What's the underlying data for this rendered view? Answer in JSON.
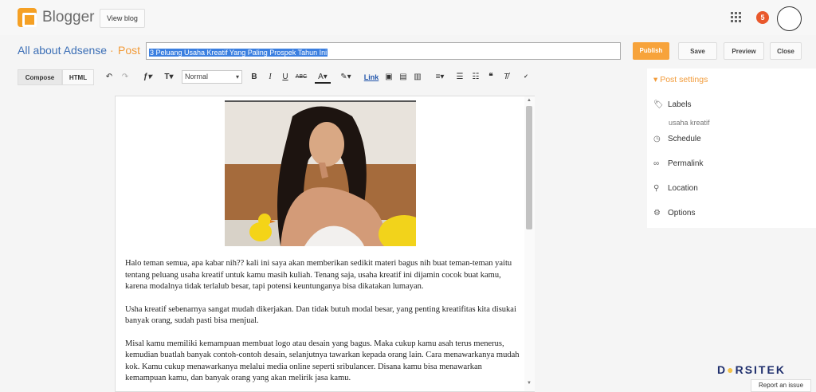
{
  "header": {
    "brand": "Blogger",
    "view_blog_label": "View blog",
    "notification_count": "5"
  },
  "title_row": {
    "blog_name": "All about Adsense",
    "separator": "·",
    "post_label": "Post",
    "title_value": "3 Peluang Usaha Kreatif Yang Paling Prospek Tahun Ini"
  },
  "actions": {
    "publish": "Publish",
    "save": "Save",
    "preview": "Preview",
    "close": "Close"
  },
  "toolbar": {
    "compose": "Compose",
    "html": "HTML",
    "font_size_icon": "ƒ",
    "text_size_icon": "T",
    "format_select": "Normal",
    "bold": "B",
    "italic": "I",
    "underline": "U",
    "strike": "ABC",
    "link": "Link"
  },
  "post": {
    "paragraphs": [
      "Halo teman semua, apa kabar nih?? kali ini saya akan memberikan sedikit materi bagus nih buat teman-teman yaitu tentang peluang usaha kreatif untuk kamu masih kuliah. Tenang saja, usaha kreatif ini dijamin cocok buat kamu, karena modalnya tidak terlalub besar, tapi potensi keuntunganya bisa dikatakan lumayan.",
      "Usha kreatif sebenarnya sangat mudah dikerjakan. Dan tidak butuh modal besar, yang penting kreatifitas kita disukai banyak orang, sudah pasti bisa menjual.",
      "Misal kamu memiliki kemampuan membuat logo atau desain yang bagus. Maka cukup kamu asah terus menerus, kemudian buatlah banyak contoh-contoh desain, selanjutnya tawarkan kepada orang lain. Cara menawarkanya mudah kok. Kamu cukup menawarkanya melalui media online seperti sribulancer. Disana kamu bisa menawarkan kemampuan kamu, dan banyak orang yang akan melirik jasa kamu."
    ]
  },
  "sidebar": {
    "heading": "Post settings",
    "labels": "Labels",
    "labels_value": "usaha kreatif",
    "schedule": "Schedule",
    "permalink": "Permalink",
    "location": "Location",
    "options": "Options"
  },
  "watermark": {
    "text_a": "D",
    "text_b": "RSITEK",
    "report": "Report an issue"
  },
  "colors": {
    "accent_orange": "#f29b39",
    "link_blue": "#3c6fb6",
    "selection_blue": "#3b7fe0"
  }
}
